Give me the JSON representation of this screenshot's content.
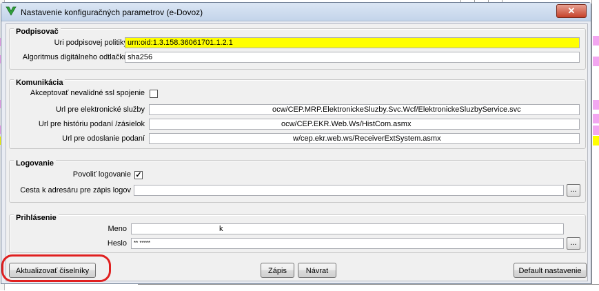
{
  "dialog": {
    "title": "Nastavenie konfiguračných parametrov (e-Dovoz)",
    "close_label": "✕"
  },
  "podpisovac": {
    "title": "Podpisovač",
    "policy_uri_label": "Uri podpisovej politiky",
    "policy_uri_value": "urn:oid:1.3.158.36061701.1.2.1",
    "hash_alg_label": "Algoritmus digitálneho odtlačku",
    "hash_alg_value": "sha256"
  },
  "komunikacia": {
    "title": "Komunikácia",
    "accept_ssl_label": "Akceptovať nevalidné ssl spojenie",
    "accept_ssl_checked": false,
    "url_services_label": "Url pre elektronické služby",
    "url_services_value": "ocw/CEP.MRP.ElektronickeSluzby.Svc.Wcf/ElektronickeSluzbyService.svc",
    "url_history_label": "Url pre históriu podaní /zásielok",
    "url_history_value": "ocw/CEP.EKR.Web.Ws/HistCom.asmx",
    "url_send_label": "Url pre odoslanie podaní",
    "url_send_value": "w/cep.ekr.web.ws/ReceiverExtSystem.asmx"
  },
  "logovanie": {
    "title": "Logovanie",
    "enable_label": "Povoliť logovanie",
    "enable_checked": "✓",
    "path_label": "Cesta k adresáru pre zápis logov",
    "path_value": "",
    "browse_label": "..."
  },
  "prihlasenie": {
    "title": "Prihlásenie",
    "name_label": "Meno",
    "name_value": "k",
    "password_label": "Heslo",
    "password_value": "**                 *****",
    "browse_label": "..."
  },
  "buttons": {
    "update": "Aktualizovať číselníky",
    "save": "Zápis",
    "back": "Návrat",
    "default": "Default nastavenie"
  },
  "colors": {
    "highlight_field": "#ffff00",
    "annotation_ring": "#e02020",
    "background_magenta": "#f3a6f0"
  }
}
